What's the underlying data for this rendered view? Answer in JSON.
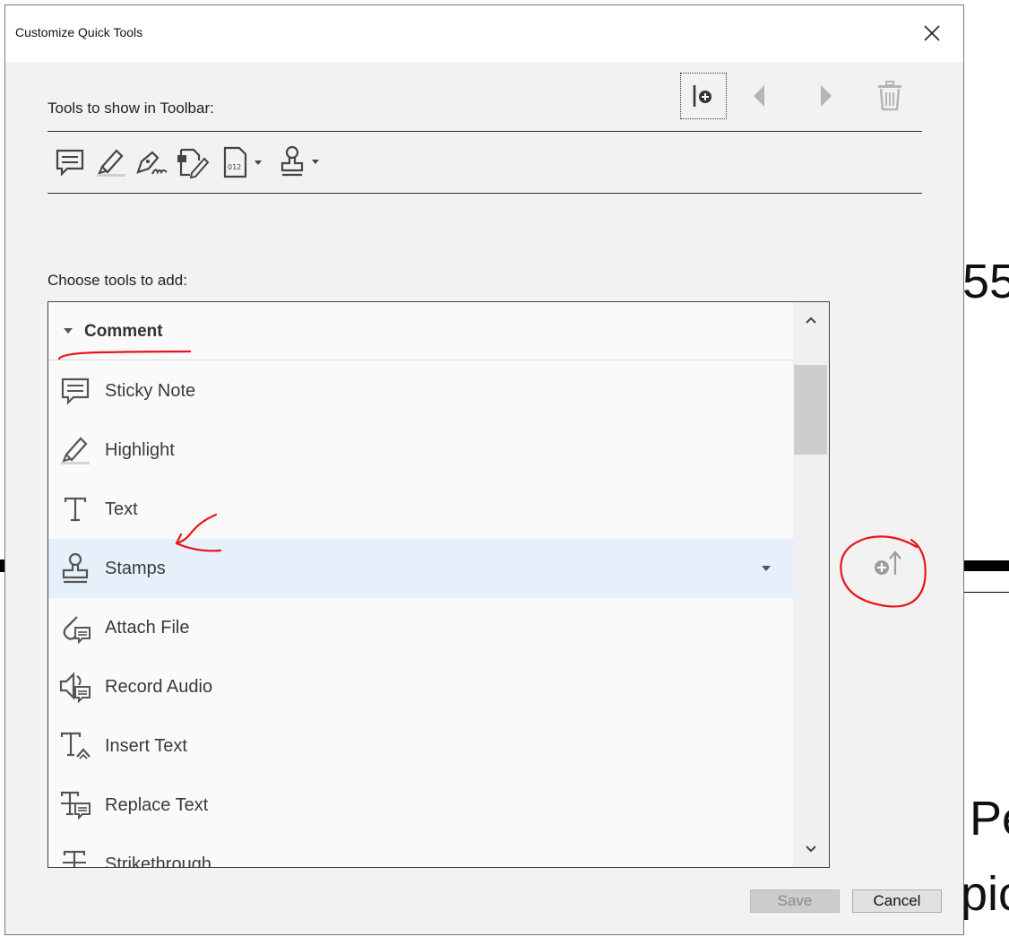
{
  "background": {
    "text_55": "55",
    "text_pe": "Pe",
    "text_pic": "pic"
  },
  "dialog": {
    "title": "Customize Quick Tools",
    "toolbar_label": "Tools to show in Toolbar:",
    "choose_label": "Choose tools to add:",
    "top_icons": [
      "add-separator-icon",
      "move-left-icon",
      "move-right-icon",
      "delete-icon"
    ],
    "toolbar_tools": [
      "comment-icon",
      "highlight-icon",
      "sign-icon",
      "fill-sign-icon",
      "bates-number-icon",
      "stamp-icon"
    ],
    "group": {
      "title": "Comment",
      "expanded": true
    },
    "tools": [
      {
        "label": "Sticky Note",
        "icon": "sticky-note-icon"
      },
      {
        "label": "Highlight",
        "icon": "highlight-icon"
      },
      {
        "label": "Text",
        "icon": "text-icon"
      },
      {
        "label": "Stamps",
        "icon": "stamp-icon",
        "selected": true,
        "has_dropdown": true
      },
      {
        "label": "Attach File",
        "icon": "attach-file-icon"
      },
      {
        "label": "Record Audio",
        "icon": "record-audio-icon"
      },
      {
        "label": "Insert Text",
        "icon": "insert-text-icon"
      },
      {
        "label": "Replace Text",
        "icon": "replace-text-icon"
      },
      {
        "label": "Strikethrough",
        "icon": "strikethrough-icon"
      }
    ],
    "add_to_toolbar_icon": "add-to-toolbar-icon",
    "buttons": {
      "save": "Save",
      "cancel": "Cancel"
    },
    "colors": {
      "selected_row": "#e6f0fb",
      "annotation": "#e8141b"
    }
  }
}
